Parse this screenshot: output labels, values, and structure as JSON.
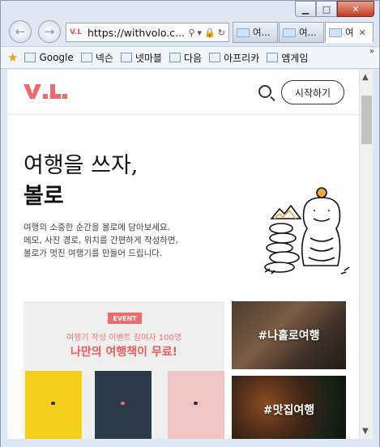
{
  "browser": {
    "address": {
      "url": "https://withvolo.c...",
      "favicon": "V.L"
    },
    "tabs": [
      {
        "label": "여..."
      },
      {
        "label": "여..."
      },
      {
        "label": "여"
      }
    ],
    "favorites": [
      {
        "label": "Google"
      },
      {
        "label": "넥슨"
      },
      {
        "label": "넷마블"
      },
      {
        "label": "다음"
      },
      {
        "label": "아프리카"
      },
      {
        "label": "엠게임"
      }
    ]
  },
  "header": {
    "start_label": "시작하기"
  },
  "hero": {
    "line1": "여행을 쓰자,",
    "line2": "볼로",
    "description": [
      "여행의 소중한 순간을 볼로에 담아보세요.",
      "메모, 사진 경로, 위치를 간편하게 작성하면,",
      "볼로가 멋진 여행기를 만들어 드립니다."
    ]
  },
  "event_card": {
    "badge": "EVENT",
    "subtitle": "여행기 작성 이벤트 참여자 100명",
    "title": "나만의 여행책이 무료!"
  },
  "photo_cards": [
    {
      "tag": "#나홀로여행"
    },
    {
      "tag": "#맛집여행"
    }
  ],
  "colors": {
    "accent": "#ef6b6b"
  }
}
